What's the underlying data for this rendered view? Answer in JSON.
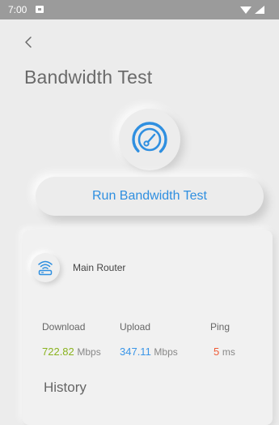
{
  "status_bar": {
    "time": "7:00"
  },
  "page": {
    "title": "Bandwidth Test"
  },
  "actions": {
    "run_label": "Run Bandwidth Test"
  },
  "router": {
    "name": "Main Router"
  },
  "metrics": {
    "download_label": "Download",
    "upload_label": "Upload",
    "ping_label": "Ping",
    "download_value": "722.82",
    "download_unit": "Mbps",
    "upload_value": "347.11",
    "upload_unit": "Mbps",
    "ping_value": "5",
    "ping_unit": "ms"
  },
  "history": {
    "title": "History"
  },
  "colors": {
    "accent": "#2f8fe0",
    "download": "#8ab31f",
    "upload": "#3a96e8",
    "ping": "#f05a35"
  },
  "icons": {
    "back": "chevron-left-icon",
    "gauge": "speedometer-icon",
    "router": "wifi-router-icon",
    "notification": "notification-icon",
    "wifi": "wifi-signal-icon",
    "signal": "cell-signal-icon"
  }
}
